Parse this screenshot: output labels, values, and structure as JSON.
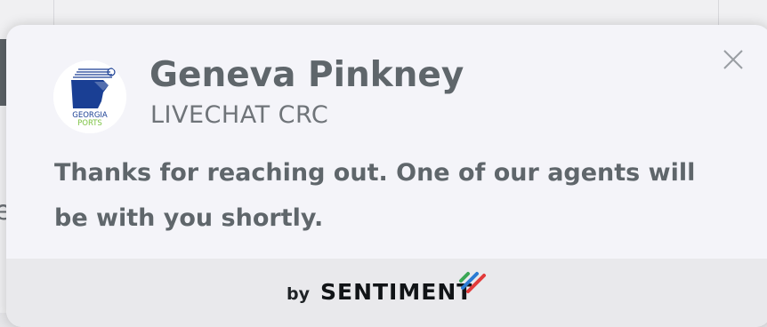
{
  "notification": {
    "agent_name": "Geneva Pinkney",
    "department": "LIVECHAT CRC",
    "message": "Thanks for reaching out. One of our agents will be with you shortly.",
    "avatar": {
      "logo_line1": "GEORGIA",
      "logo_line2": "PORTS",
      "icon": "georgia-ports-logo"
    },
    "close_icon": "close-icon"
  },
  "footer": {
    "by_label": "by",
    "brand": "SENTIMENT",
    "brand_colors": [
      "#3aa655",
      "#2a7bd4",
      "#e23a3a"
    ]
  },
  "background": {
    "partial_text": "e"
  },
  "colors": {
    "text_primary": "#5f666b",
    "popup_bg": "#f4f4f9",
    "footer_bg": "#e9e9ec",
    "logo_blue": "#1a3f94",
    "logo_green": "#7cc242"
  }
}
